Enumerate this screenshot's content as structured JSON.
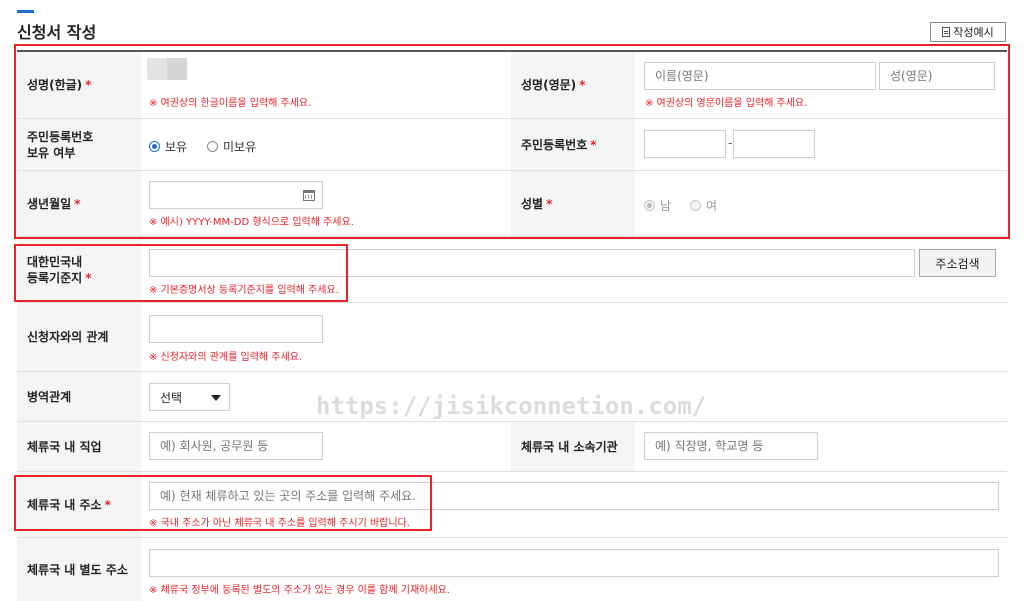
{
  "header": {
    "title": "신청서 작성",
    "example_button": "작성예시",
    "example_icon": "document-icon"
  },
  "required_mark": "*",
  "rows": {
    "korean_name": {
      "label": "성명(한글)",
      "hint": "※ 여권상의 한글이름을 입력해 주세요."
    },
    "english_name": {
      "label": "성명(영문)",
      "given_placeholder": "이름(영문)",
      "family_placeholder": "성(영문)",
      "hint": "※ 여권상의 영문이름을 입력해 주세요."
    },
    "rrn_holding": {
      "label_line1": "주민등록번호",
      "label_line2": "보유 여부",
      "options": [
        "보유",
        "미보유"
      ],
      "selected": "보유"
    },
    "rrn": {
      "label": "주민등록번호",
      "separator": "-"
    },
    "birthdate": {
      "label": "생년월일",
      "hint": "※ 예시) YYYY-MM-DD 형식으로 입력해 주세요."
    },
    "gender": {
      "label": "성별",
      "options": [
        "남",
        "여"
      ],
      "selected": "남"
    },
    "domicile": {
      "label_line1": "대한민국내",
      "label_line2": "등록기준지",
      "hint": "※ 기본증명서상 등록기준지를 입력해 주세요.",
      "search_button": "주소검색"
    },
    "relation": {
      "label": "신청자와의 관계",
      "hint": "※ 신청자와의 관계를 입력해 주세요."
    },
    "military": {
      "label": "병역관계",
      "selected": "선택"
    },
    "occupation": {
      "label": "체류국 내 직업",
      "placeholder": "예) 회사원, 공무원 등"
    },
    "organization": {
      "label": "체류국 내 소속기관",
      "placeholder": "예) 직장명, 학교명 등"
    },
    "address": {
      "label": "체류국 내 주소",
      "placeholder": "예) 현재 체류하고 있는 곳의 주소를 입력해 주세요.",
      "hint": "※ 국내 주소가 아닌 체류국 내 주소를 입력해 주시기 바랍니다."
    },
    "alt_address": {
      "label": "체류국 내 별도 주소",
      "hint": "※ 체류국 정부에 등록된 별도의 주소가 있는 경우 이를 함께 기재하세요."
    }
  },
  "watermark": "https://jisikconnetion.com/",
  "colors": {
    "required": "#e8232a",
    "accent": "#1f6fd1",
    "highlight_box": "#e8232a",
    "label_bg": "#f4f5f7"
  }
}
